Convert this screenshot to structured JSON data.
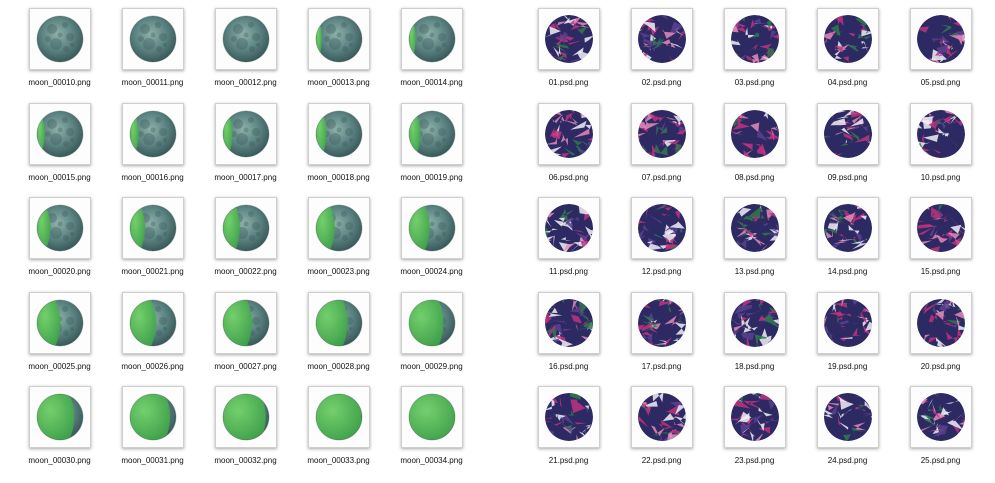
{
  "left_folder": {
    "files": [
      {
        "name": "moon_00010.png",
        "lit_fraction": 0.0
      },
      {
        "name": "moon_00011.png",
        "lit_fraction": 0.0
      },
      {
        "name": "moon_00012.png",
        "lit_fraction": 0.0
      },
      {
        "name": "moon_00013.png",
        "lit_fraction": 0.02
      },
      {
        "name": "moon_00014.png",
        "lit_fraction": 0.04
      },
      {
        "name": "moon_00015.png",
        "lit_fraction": 0.06
      },
      {
        "name": "moon_00016.png",
        "lit_fraction": 0.08
      },
      {
        "name": "moon_00017.png",
        "lit_fraction": 0.1
      },
      {
        "name": "moon_00018.png",
        "lit_fraction": 0.12
      },
      {
        "name": "moon_00019.png",
        "lit_fraction": 0.14
      },
      {
        "name": "moon_00020.png",
        "lit_fraction": 0.18
      },
      {
        "name": "moon_00021.png",
        "lit_fraction": 0.22
      },
      {
        "name": "moon_00022.png",
        "lit_fraction": 0.26
      },
      {
        "name": "moon_00023.png",
        "lit_fraction": 0.3
      },
      {
        "name": "moon_00024.png",
        "lit_fraction": 0.34
      },
      {
        "name": "moon_00025.png",
        "lit_fraction": 0.4
      },
      {
        "name": "moon_00026.png",
        "lit_fraction": 0.46
      },
      {
        "name": "moon_00027.png",
        "lit_fraction": 0.52
      },
      {
        "name": "moon_00028.png",
        "lit_fraction": 0.58
      },
      {
        "name": "moon_00029.png",
        "lit_fraction": 0.64
      },
      {
        "name": "moon_00030.png",
        "lit_fraction": 0.7
      },
      {
        "name": "moon_00031.png",
        "lit_fraction": 0.76
      },
      {
        "name": "moon_00032.png",
        "lit_fraction": 0.82
      },
      {
        "name": "moon_00033.png",
        "lit_fraction": 0.88
      },
      {
        "name": "moon_00034.png",
        "lit_fraction": 0.94
      }
    ]
  },
  "right_folder": {
    "files": [
      {
        "name": "01.psd.png"
      },
      {
        "name": "02.psd.png"
      },
      {
        "name": "03.psd.png"
      },
      {
        "name": "04.psd.png"
      },
      {
        "name": "05.psd.png"
      },
      {
        "name": "06.psd.png"
      },
      {
        "name": "07.psd.png"
      },
      {
        "name": "08.psd.png"
      },
      {
        "name": "09.psd.png"
      },
      {
        "name": "10.psd.png"
      },
      {
        "name": "11.psd.png"
      },
      {
        "name": "12.psd.png"
      },
      {
        "name": "13.psd.png"
      },
      {
        "name": "14.psd.png"
      },
      {
        "name": "15.psd.png"
      },
      {
        "name": "16.psd.png"
      },
      {
        "name": "17.psd.png"
      },
      {
        "name": "18.psd.png"
      },
      {
        "name": "19.psd.png"
      },
      {
        "name": "20.psd.png"
      },
      {
        "name": "21.psd.png"
      },
      {
        "name": "22.psd.png"
      },
      {
        "name": "23.psd.png"
      },
      {
        "name": "24.psd.png"
      },
      {
        "name": "25.psd.png"
      }
    ]
  },
  "colors": {
    "moon_dark": "#3a5a5a",
    "moon_mid": "#5d8583",
    "moon_light": "#8fb1ab",
    "moon_lit": "#74d36a",
    "moon_lit_shade": "#3fa34a",
    "collage_navy": "#2d2a63",
    "collage_purple": "#5a3f8e",
    "collage_magenta": "#c0327e",
    "collage_pink": "#e58ab8",
    "collage_white": "#f2eff6",
    "collage_green": "#2f7a4b"
  }
}
